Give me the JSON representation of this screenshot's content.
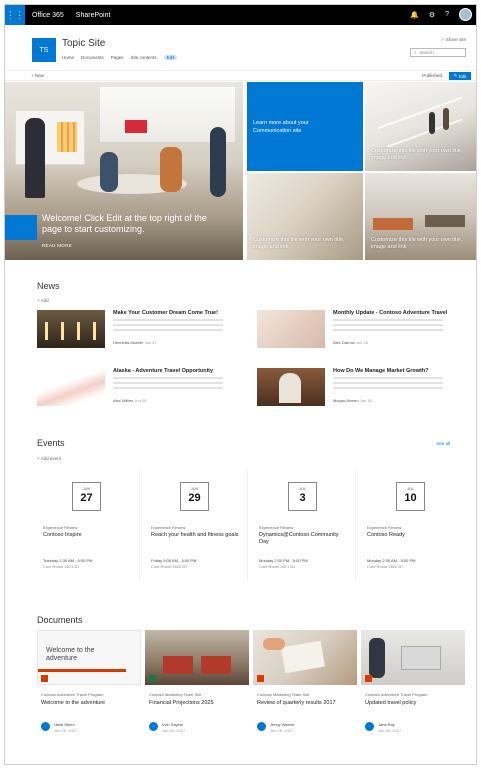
{
  "suite": {
    "app": "Office 365",
    "product": "SharePoint"
  },
  "site": {
    "logo": "TS",
    "title": "Topic Site",
    "nav": [
      "Home",
      "Documents",
      "Pages",
      "Site contents",
      "Edit"
    ],
    "share": "Share site",
    "search_placeholder": "Search"
  },
  "commandbar": {
    "new": "+ New",
    "published": "Published",
    "edit": "Edit"
  },
  "hero": {
    "main_text": "Welcome! Click Edit at the top right of the page to start customizing.",
    "read_more": "READ MORE",
    "tiles": [
      "Learn more about your Communication site",
      "Customize this tile with your own title, image and link",
      "Customize this tile with your own title, image and link",
      "Customize this tile with your own title, image and link"
    ]
  },
  "news": {
    "title": "News",
    "add": "+ Add",
    "items": [
      {
        "title": "Make Your Customer Dream Come True!",
        "author": "Henrietta Mueller",
        "date": "Jun 27"
      },
      {
        "title": "Monthly Update - Contoso Adventure Travel",
        "author": "Alex Darrow",
        "date": "Jun 26"
      },
      {
        "title": "Alaska - Adventure Travel Opportunity",
        "author": "Alex Wilber",
        "date": "Jun 20"
      },
      {
        "title": "How Do We Manage Market Growth?",
        "author": "Megan Bowen",
        "date": "Jun 18"
      }
    ]
  },
  "events": {
    "title": "Events",
    "add": "+ Add event",
    "see_all": "See all",
    "items": [
      {
        "month": "JUN",
        "day": "27",
        "category": "Experience Review",
        "title": "Contoso Inspire",
        "time": "Tuesday 2:30 AM - 5:00 PM",
        "location": "Conf Room 2671 B1"
      },
      {
        "month": "JUN",
        "day": "29",
        "category": "Experience Review",
        "title": "Reach your health and fitness goals",
        "time": "Friday 9:00 AM - 5:00 PM",
        "location": "Conf Room 2620 B7"
      },
      {
        "month": "JUL",
        "day": "3",
        "category": "Experience Review",
        "title": "Dynamics@Contoso Community Day",
        "time": "Monday 2:30 PM - 5:00 PM",
        "location": "Conf Room 2671 B1"
      },
      {
        "month": "JUL",
        "day": "10",
        "category": "Experience Review",
        "title": "Contoso Ready",
        "time": "Monday 2:30 AM - 5:00 PM",
        "location": "Conf Room 2620 B7"
      }
    ]
  },
  "documents": {
    "title": "Documents",
    "items": [
      {
        "thumb_text": "Welcome to the adventure",
        "site": "Contoso Adventure Travel Program",
        "title": "Welcome to the adventure",
        "person": "Heidi Steen",
        "date": "Jun 16, 2017"
      },
      {
        "site": "Contoso Marketing Team Site",
        "title": "Financial Projections 2025",
        "person": "Irvin Sayers",
        "date": "Jun 20, 2017"
      },
      {
        "site": "Contoso Marketing Team Site",
        "title": "Review of quarterly results 2017",
        "person": "Jenny Warner",
        "date": "Jun 26, 2017"
      },
      {
        "site": "Contoso Adventure Travel Program",
        "title": "Updated travel policy",
        "person": "Jane Ray",
        "date": "Jun 26, 2017"
      }
    ]
  },
  "colors": {
    "accent": "#0078d4",
    "suite_bar": "#000000",
    "doc_badge": "#d83b01"
  },
  "icons": [
    "waffle-icon",
    "notifications-icon",
    "settings-icon",
    "help-icon",
    "search-icon",
    "edit-icon",
    "share-icon"
  ]
}
